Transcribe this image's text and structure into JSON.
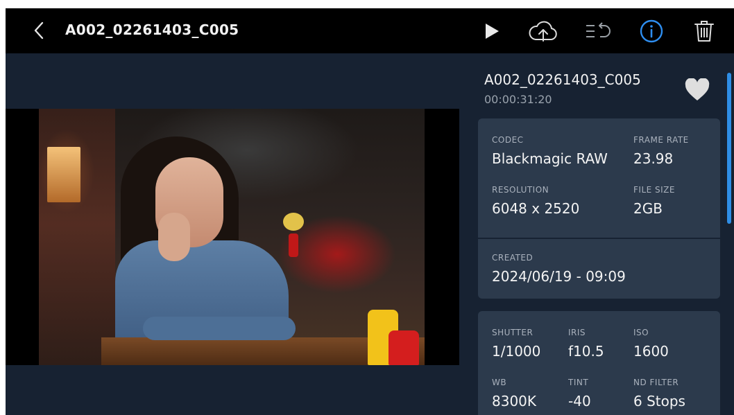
{
  "header": {
    "back_icon": "chevron-left-icon",
    "clip_title": "A002_02261403_C005",
    "icons": [
      "play-icon",
      "cloud-upload-icon",
      "list-undo-icon",
      "info-icon",
      "trash-icon"
    ],
    "info_active_color": "#2e8ef0"
  },
  "panel": {
    "clip_name": "A002_02261403_C005",
    "timecode": "00:00:31:20",
    "favorite_icon": "heart-icon",
    "card_a": {
      "codec_label": "CODEC",
      "codec_value": "Blackmagic RAW",
      "frame_rate_label": "FRAME RATE",
      "frame_rate_value": "23.98",
      "resolution_label": "RESOLUTION",
      "resolution_value": "6048 x 2520",
      "file_size_label": "FILE SIZE",
      "file_size_value": "2GB"
    },
    "card_b": {
      "created_label": "CREATED",
      "created_value": "2024/06/19 - 09:09"
    },
    "card_c": {
      "shutter_label": "SHUTTER",
      "shutter_value": "1/1000",
      "iris_label": "IRIS",
      "iris_value": "f10.5",
      "iso_label": "ISO",
      "iso_value": "1600",
      "wb_label": "WB",
      "wb_value": "8300K",
      "tint_label": "TINT",
      "tint_value": "-40",
      "nd_label": "ND FILTER",
      "nd_value": "6 Stops"
    }
  },
  "colors": {
    "background": "#172232",
    "topbar": "#000000",
    "card": "#2c3a4c",
    "accent": "#2e8ef0"
  }
}
